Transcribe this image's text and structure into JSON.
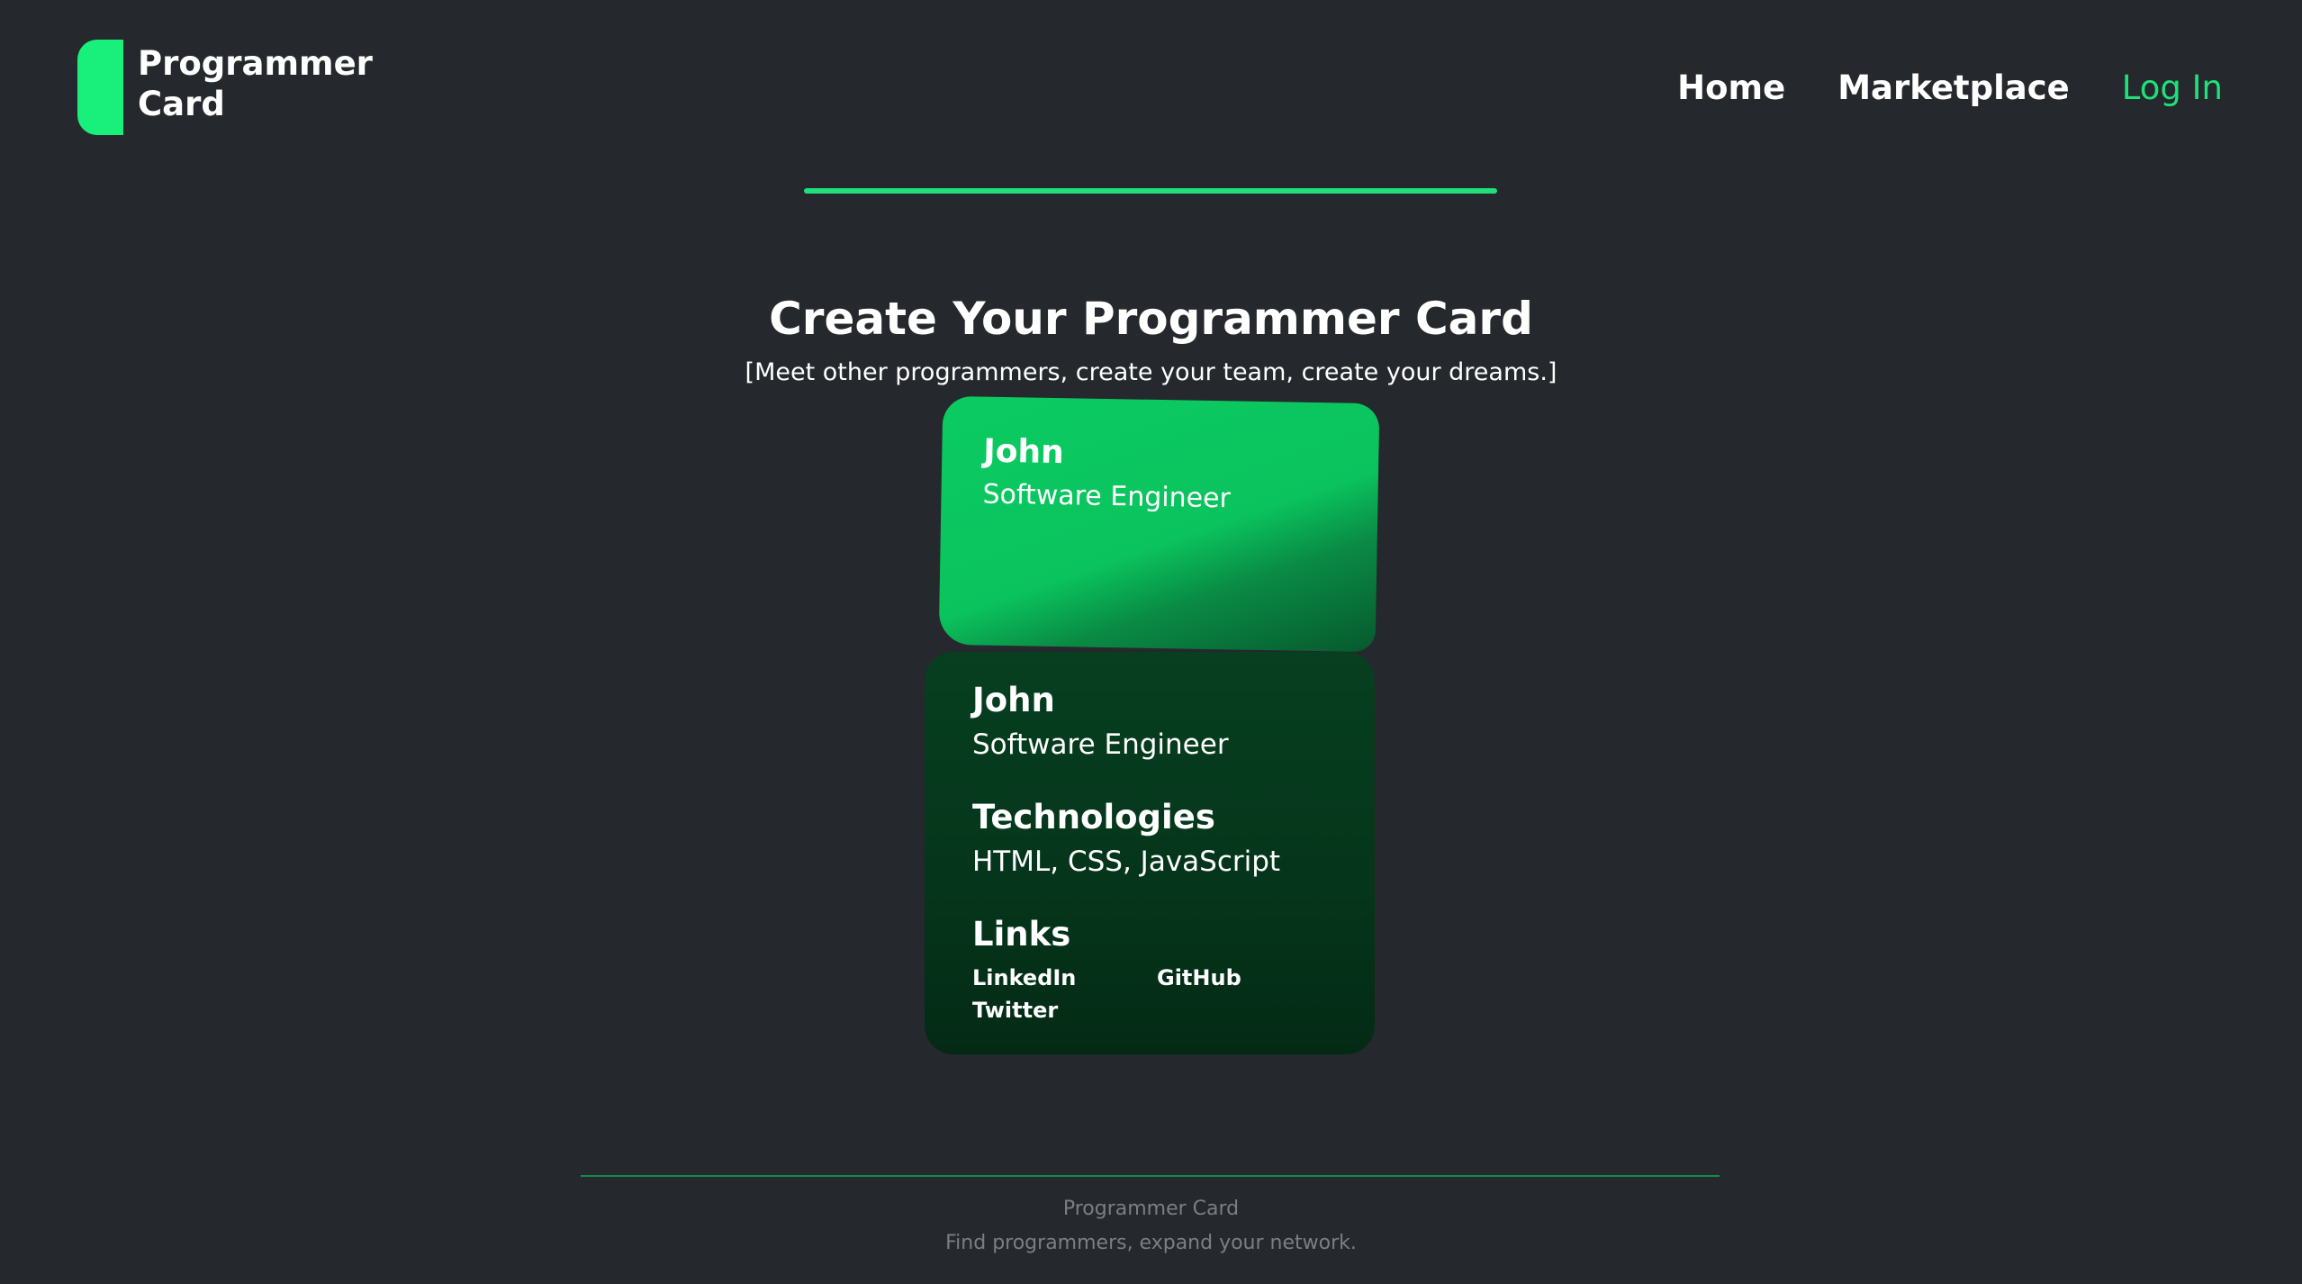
{
  "header": {
    "logo_line1": "Programmer",
    "logo_line2": "Card",
    "nav": {
      "home": "Home",
      "marketplace": "Marketplace",
      "login": "Log In"
    }
  },
  "hero": {
    "title": "Create Your Programmer Card",
    "subtitle": "[Meet other programmers, create your team, create your dreams.]"
  },
  "card_front": {
    "name": "John",
    "role": "Software Engineer"
  },
  "card_back": {
    "name": "John",
    "role": "Software Engineer",
    "technologies_heading": "Technologies",
    "technologies": "HTML, CSS, JavaScript",
    "links_heading": "Links",
    "links": [
      "LinkedIn",
      "GitHub",
      "Twitter"
    ]
  },
  "footer": {
    "title": "Programmer Card",
    "tagline": "Find programmers, expand your network."
  },
  "colors": {
    "background": "#25282c",
    "accent": "#19f07c",
    "card_front": "#0bc35e",
    "card_back": "#05351b"
  }
}
